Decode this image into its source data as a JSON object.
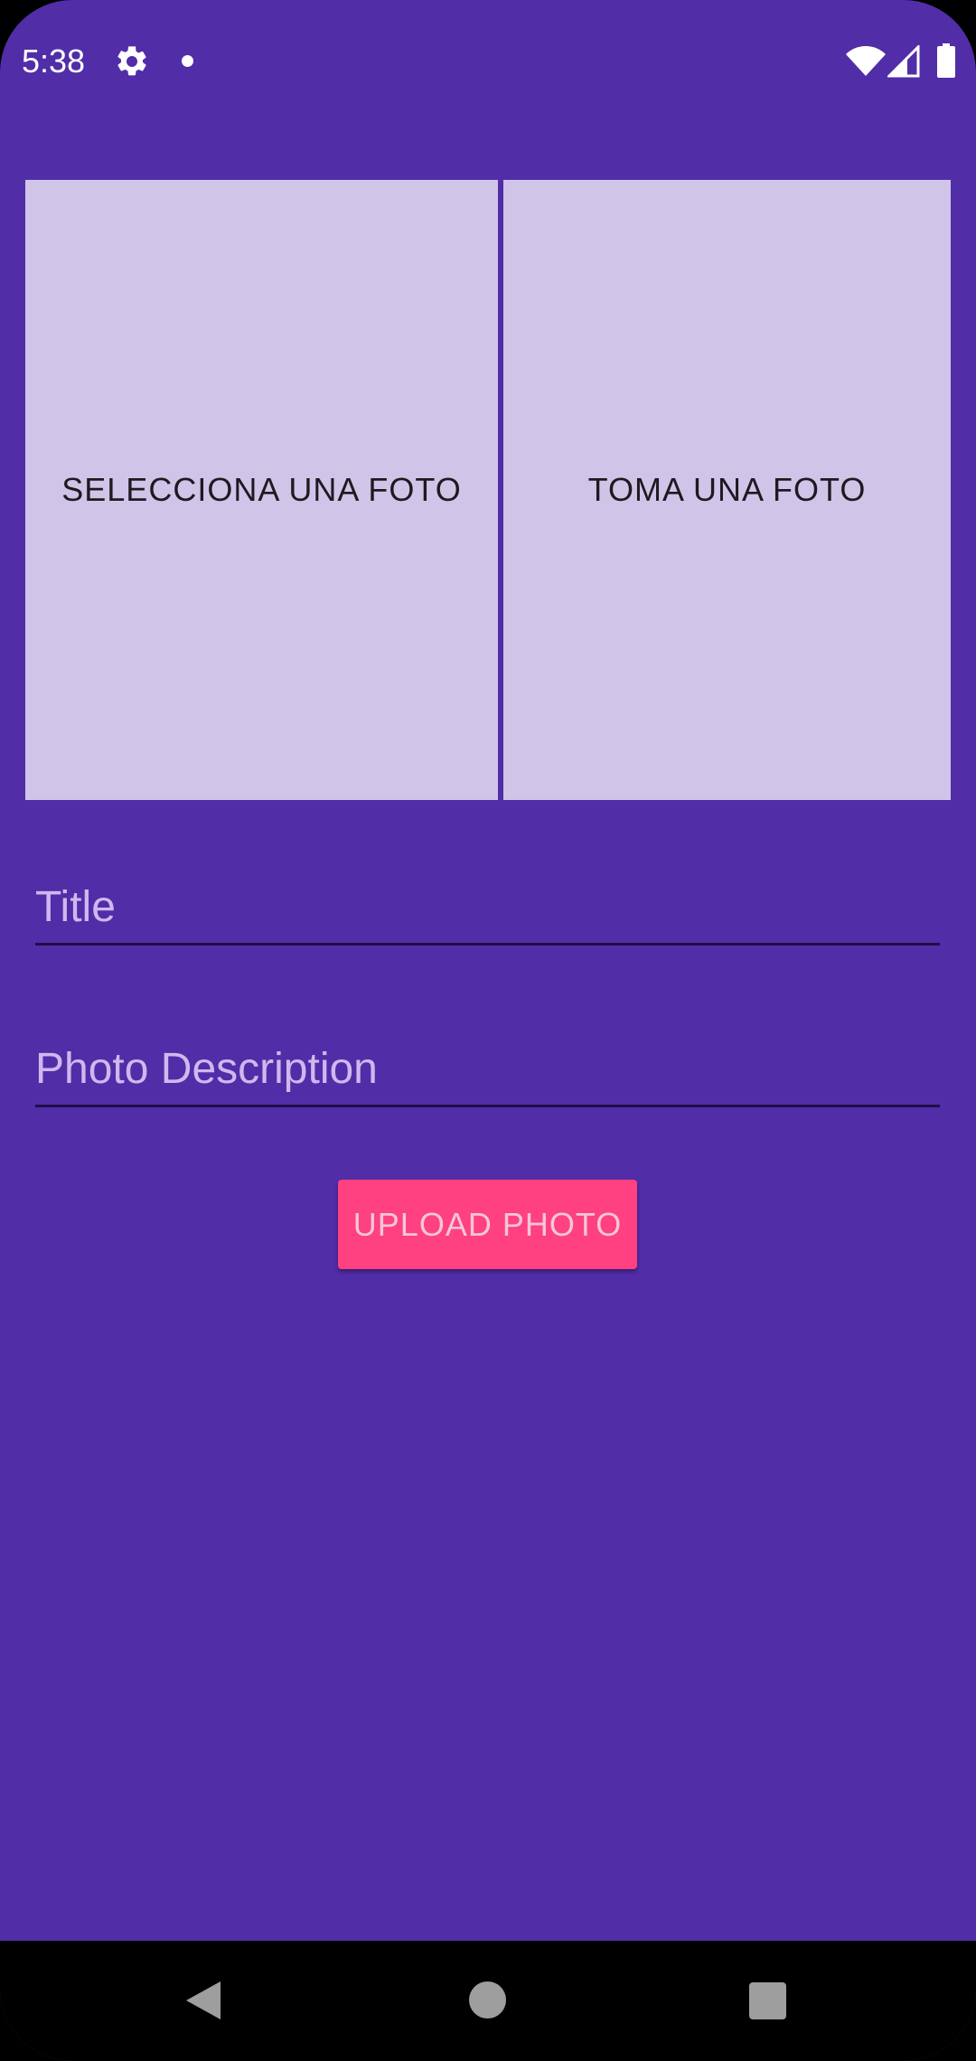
{
  "status_bar": {
    "time": "5:38",
    "icons": [
      "gear-icon",
      "notification-dot-icon",
      "wifi-icon",
      "cellular-signal-icon",
      "battery-icon"
    ]
  },
  "photo_actions": {
    "select_label": "SELECCIONA UNA FOTO",
    "take_label": "TOMA UNA FOTO"
  },
  "form": {
    "title": {
      "value": "",
      "placeholder": "Title"
    },
    "description": {
      "value": "",
      "placeholder": "Photo Description"
    },
    "upload_label": "UPLOAD PHOTO"
  },
  "nav_bar": {
    "icons": [
      "back-icon",
      "home-icon",
      "recents-icon"
    ]
  },
  "colors": {
    "background": "#512DA8",
    "photo_button": "#D1C4E9",
    "accent": "#FF4081"
  }
}
